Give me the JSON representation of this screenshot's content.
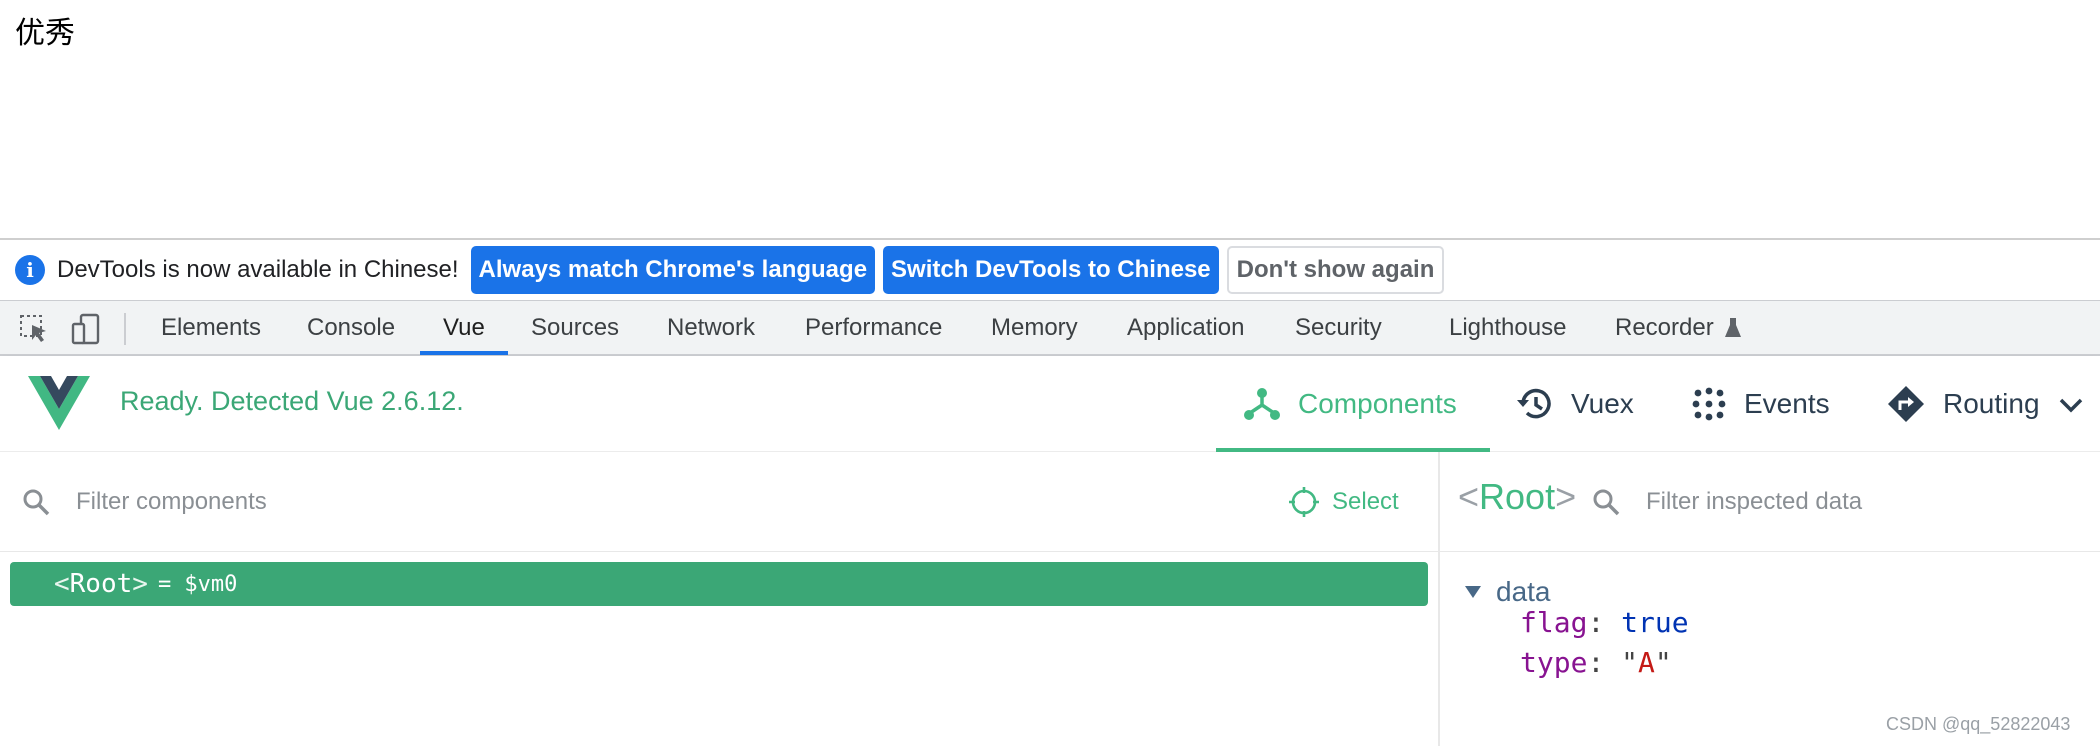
{
  "page": {
    "text": "优秀"
  },
  "infobar": {
    "message": "DevTools is now available in Chinese!",
    "buttons": [
      "Always match Chrome's language",
      "Switch DevTools to Chinese",
      "Don't show again"
    ]
  },
  "devtools_tabs": [
    "Elements",
    "Console",
    "Vue",
    "Sources",
    "Network",
    "Performance",
    "Memory",
    "Application",
    "Security",
    "Lighthouse",
    "Recorder"
  ],
  "active_tab": "Vue",
  "vue": {
    "status": "Ready. Detected Vue 2.6.12.",
    "nav": [
      "Components",
      "Vuex",
      "Events",
      "Routing"
    ],
    "active_nav": "Components",
    "accent": "#42b983"
  },
  "components": {
    "filter_placeholder": "Filter components",
    "select_label": "Select",
    "root": {
      "open": "<",
      "name": "Root",
      "close": ">",
      "vm": "= $vm0"
    }
  },
  "inspector": {
    "root_open": "<",
    "root_name": "Root",
    "root_close": ">",
    "filter_placeholder": "Filter inspected data",
    "section": "data",
    "props": [
      {
        "key": "flag",
        "value": "true"
      },
      {
        "key": "type",
        "value": "A"
      }
    ]
  },
  "watermark": "CSDN @qq_52822043"
}
